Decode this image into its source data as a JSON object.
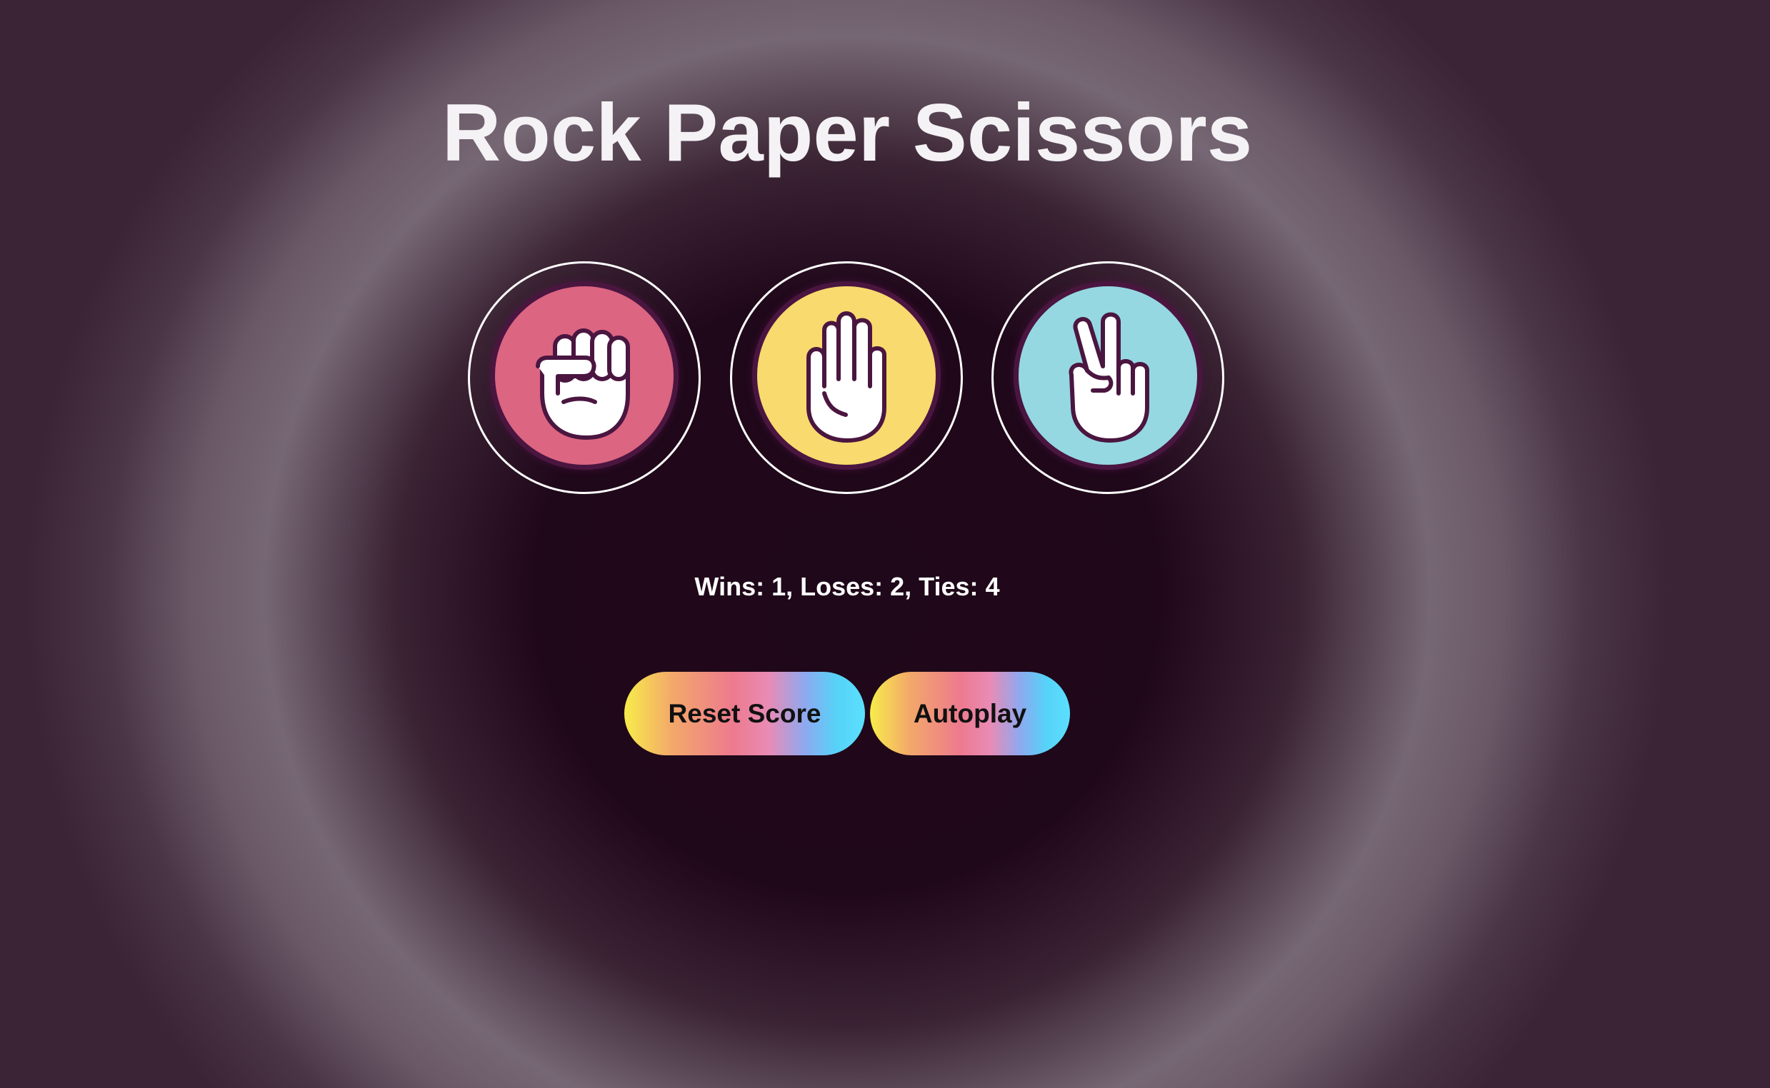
{
  "title": "Rock Paper Scissors",
  "moves": [
    {
      "id": "rock",
      "name": "Rock",
      "icon": "fist-icon",
      "color": "#dc6582"
    },
    {
      "id": "paper",
      "name": "Paper",
      "icon": "open-hand-icon",
      "color": "#f8da6e"
    },
    {
      "id": "scissors",
      "name": "Scissors",
      "icon": "peace-hand-icon",
      "color": "#95d8e1"
    }
  ],
  "score": {
    "wins": 1,
    "loses": 2,
    "ties": 4,
    "text": "Wins: 1, Loses: 2, Ties: 4"
  },
  "buttons": {
    "reset_label": "Reset Score",
    "autoplay_label": "Autoplay"
  },
  "colors": {
    "background_center": "#1f0819",
    "icon_outline": "#4a1640",
    "text": "#ffffff"
  }
}
